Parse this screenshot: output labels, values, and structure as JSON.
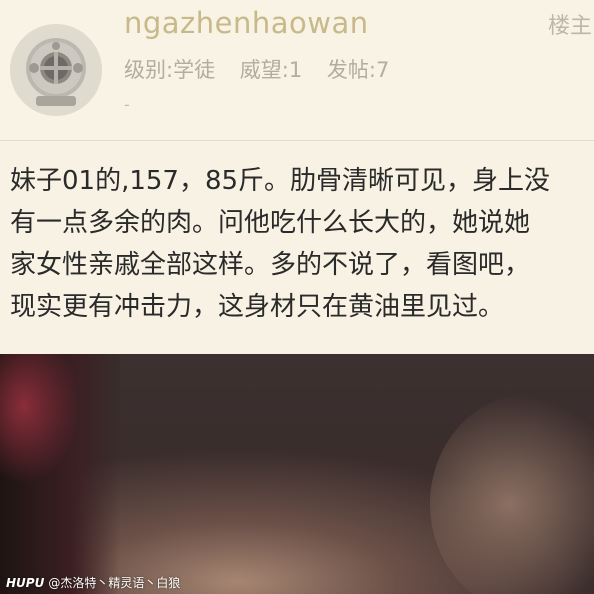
{
  "post": {
    "username": "ngazhenhaowan",
    "floor_label": "楼主",
    "meta": {
      "level": "级别:学徒",
      "prestige": "威望:1",
      "posts": "发帖:7"
    },
    "signature": "-",
    "avatar_icon": "diving-helmet-icon",
    "body": "妹子01的,157，85斤。肋骨清晰可见，身上没\n有一点多余的肉。问他吃什么长大的，她说她\n家女性亲戚全部这样。多的不说了，看图吧，\n现实更有冲击力，这身材只在黄油里见过。"
  },
  "watermark": {
    "brand": "HUPU",
    "text": "@杰洛特丶精灵语丶白狼"
  },
  "colors": {
    "header_bg": "#f8f3e4",
    "username": "#c8b98a",
    "meta": "#b3ada0",
    "body_text": "#2a2a2a"
  }
}
